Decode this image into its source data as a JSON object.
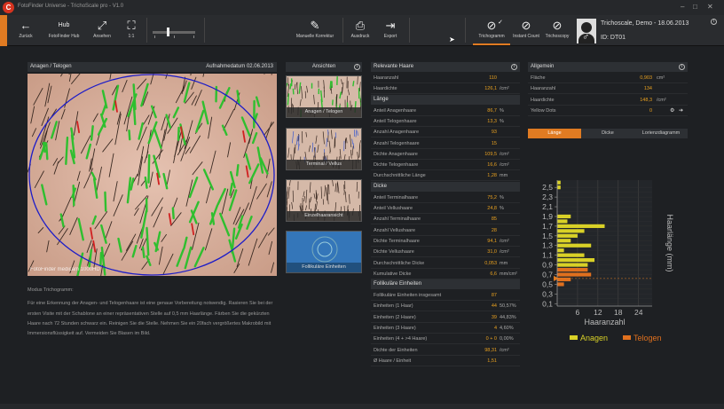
{
  "window": {
    "title": "TrichoScale pro - V1.0",
    "title_prefix": "FotoFinder Universe",
    "logo": "C"
  },
  "toolbar": {
    "buttons": [
      {
        "label": "Zurück",
        "icon": "←"
      },
      {
        "label": "FotoFinder Hub",
        "icon": "Hub"
      },
      {
        "label": "Ansehen",
        "icon": "⤢"
      },
      {
        "label": "1:1",
        "icon": "⛶"
      },
      {
        "label": "Manuelle Korrektur",
        "icon": "✎"
      },
      {
        "label": "Ausdruck",
        "icon": "⎙"
      },
      {
        "label": "Export",
        "icon": "⇥"
      },
      {
        "label": "Trichogramm",
        "icon": "⊘"
      },
      {
        "label": "Instant Count",
        "icon": "⊘"
      },
      {
        "label": "Trichoscopy",
        "icon": "⊘"
      }
    ]
  },
  "patient": {
    "name": "Trichoscale, Demo - 18.06.2013",
    "id": "ID: DT01",
    "gender": "♂"
  },
  "image_panel": {
    "title": "Anagen / Telogen",
    "date": "Aufnahmedatum 02.06.2013",
    "watermark": "FotoFinder medicam 1000HD"
  },
  "views": {
    "title": "Ansichten",
    "items": [
      "Anagen / Telogen",
      "Terminal / Vellus",
      "Einzelhaaransicht",
      "Follikuläre Einheiten"
    ]
  },
  "description": {
    "title": "Modus Trichogramm:",
    "text": "Für eine Erkennung der Anagen- und Telogenhaare ist eine genaue Vorbereitung notwendig. Rasieren Sie bei der ersten Visite mit der Schablone an einer repräsentativen Stelle auf 0,5 mm Haarlänge. Färben Sie die gekürzten Haare nach 72 Stunden schwarz ein. Reinigen Sie die Stelle. Nehmen Sie ein 20fach vergrößertes Makrobild mit Immersionsflüssigkeit auf. Vermeiden Sie Blasen im Bild."
  },
  "stats": {
    "title": "Relevante Haare",
    "top": [
      {
        "label": "Haaranzahl",
        "value": "110",
        "unit": ""
      },
      {
        "label": "Haardichte",
        "value": "126,1",
        "unit": "/cm²"
      }
    ],
    "sections": [
      {
        "title": "Länge",
        "rows": [
          {
            "label": "Anteil Anagenhaare",
            "value": "86,7",
            "unit": "%"
          },
          {
            "label": "Anteil Telogenhaare",
            "value": "13,3",
            "unit": "%"
          },
          {
            "label": "Anzahl Anagenhaare",
            "value": "93",
            "unit": ""
          },
          {
            "label": "Anzahl Telogenhaare",
            "value": "15",
            "unit": ""
          },
          {
            "label": "Dichte Anagenhaare",
            "value": "109,5",
            "unit": "/cm²"
          },
          {
            "label": "Dichte Telogenhaare",
            "value": "16,6",
            "unit": "/cm²"
          },
          {
            "label": "Durchschnittliche Länge",
            "value": "1,28",
            "unit": "mm"
          }
        ]
      },
      {
        "title": "Dicke",
        "rows": [
          {
            "label": "Anteil Terminalhaare",
            "value": "75,2",
            "unit": "%"
          },
          {
            "label": "Anteil Vellushaare",
            "value": "24,8",
            "unit": "%"
          },
          {
            "label": "Anzahl Terminalhaare",
            "value": "85",
            "unit": ""
          },
          {
            "label": "Anzahl Vellushaare",
            "value": "28",
            "unit": ""
          },
          {
            "label": "Dichte Terminalhaare",
            "value": "94,1",
            "unit": "/cm²"
          },
          {
            "label": "Dichte Vellushaare",
            "value": "31,0",
            "unit": "/cm²"
          },
          {
            "label": "Durchschnittliche Dicke",
            "value": "0,053",
            "unit": "mm"
          },
          {
            "label": "Kumulative Dicke",
            "value": "6,6",
            "unit": "mm/cm²"
          }
        ]
      },
      {
        "title": "Follikuläre Einheiten",
        "rows": [
          {
            "label": "Follikuläre Einheiten insgesamt",
            "value": "87",
            "unit": ""
          },
          {
            "label": "Einheiten (1 Haar)",
            "value": "44",
            "unit": "50,57%"
          },
          {
            "label": "Einheiten (2 Haare)",
            "value": "39",
            "unit": "44,83%"
          },
          {
            "label": "Einheiten (3 Haare)",
            "value": "4",
            "unit": "4,60%"
          },
          {
            "label": "Einheiten (4 + >4 Haare)",
            "value": "0 + 0",
            "unit": "0,00%"
          },
          {
            "label": "Dichte der Einheiten",
            "value": "98,31",
            "unit": "/cm²"
          },
          {
            "label": "Ø Haare / Einheit",
            "value": "1,51",
            "unit": ""
          }
        ]
      }
    ]
  },
  "general": {
    "title": "Allgemein",
    "rows": [
      {
        "label": "Fläche",
        "value": "0,903",
        "unit": "cm²"
      },
      {
        "label": "Haaranzahl",
        "value": "134",
        "unit": ""
      },
      {
        "label": "Haardichte",
        "value": "148,3",
        "unit": "/cm²"
      },
      {
        "label": "Yellow Dots",
        "value": "0",
        "unit": ""
      }
    ]
  },
  "tabs": [
    "Länge",
    "Dicke",
    "Lorienzdiagramm"
  ],
  "colors": {
    "accent": "#e07b22",
    "anagen": "#d9d127",
    "telogen": "#e0701e",
    "green_hair": "#2fbf2f",
    "circle": "#1c1cc8"
  },
  "chart_data": {
    "type": "bar",
    "orientation": "horizontal",
    "ylabel": "Haarlänge (mm)",
    "xlabel": "Haaranzahl",
    "yticks": [
      "0,1",
      "0,3",
      "0,5",
      "0,7",
      "0,9",
      "1,1",
      "1,3",
      "1,5",
      "1,7",
      "1,9",
      "2,1",
      "2,3",
      "2,5"
    ],
    "xticks": [
      "6",
      "12",
      "18",
      "24"
    ],
    "xlim": [
      0,
      28
    ],
    "categories": [
      0.5,
      0.6,
      0.7,
      0.8,
      0.9,
      1.0,
      1.1,
      1.2,
      1.3,
      1.4,
      1.5,
      1.6,
      1.7,
      1.8,
      1.9,
      2.0,
      2.1,
      2.2,
      2.3,
      2.4,
      2.5,
      2.6
    ],
    "series": [
      {
        "name": "Anagen",
        "color": "#d9d127",
        "values": [
          0,
          0,
          0,
          0,
          9,
          11,
          8,
          2,
          10,
          4,
          6,
          8,
          14,
          3,
          4,
          0,
          0,
          0,
          0,
          0,
          1,
          1
        ]
      },
      {
        "name": "Telogen",
        "color": "#e0701e",
        "values": [
          2,
          4,
          10,
          9,
          0,
          0,
          0,
          0,
          0,
          0,
          0,
          0,
          0,
          0,
          0,
          0,
          0,
          0,
          0,
          0,
          0,
          0
        ]
      }
    ],
    "legend_position": "bottom"
  }
}
